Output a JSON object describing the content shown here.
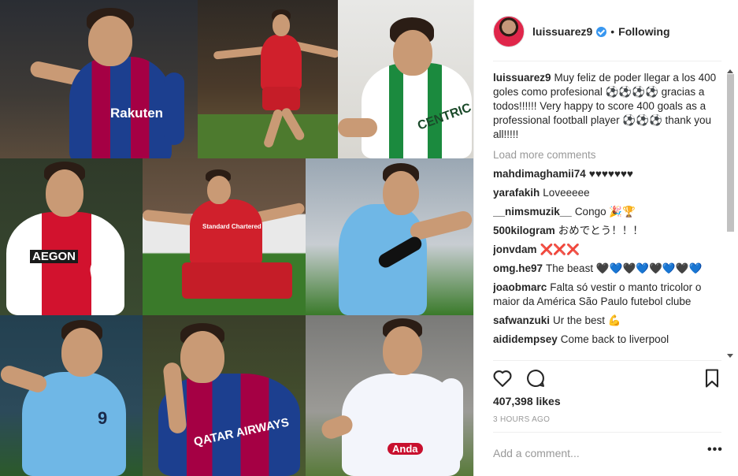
{
  "post": {
    "username": "luissuarez9",
    "follow_label": "Following",
    "dot": "•",
    "likes": "407,398 likes",
    "time_ago": "3 HOURS AGO",
    "add_comment_placeholder": "Add a comment...",
    "more_label": "•••"
  },
  "caption": {
    "user": "luissuarez9",
    "text": "Muy feliz de poder llegar a los 400 goles como profesional ⚽⚽⚽⚽ gracias a todos!!!!!! Very happy to score 400 goals as a professional football player ⚽⚽⚽ thank you all!!!!!"
  },
  "load_more": "Load more comments",
  "comments": [
    {
      "user": "mahdimaghamii74",
      "text": "♥♥♥♥♥♥♥"
    },
    {
      "user": "yarafakih",
      "text": "Loveeeee"
    },
    {
      "user": "__nimsmuzik__",
      "text": "Congo 🎉🏆"
    },
    {
      "user": "500kilogram",
      "text": "おめでとう！！！"
    },
    {
      "user": "jonvdam",
      "text": "❌❌❌"
    },
    {
      "user": "omg.he97",
      "text": "The beast 🖤💙🖤💙🖤💙🖤💙"
    },
    {
      "user": "joaobmarc",
      "text": "Falta só vestir o manto tricolor o maior da América São Paulo futebol clube"
    },
    {
      "user": "safwanzuki",
      "text": "Ur the best 💪"
    },
    {
      "user": "aididempsey",
      "text": "Come back to liverpool"
    }
  ],
  "kits": {
    "barca_sponsor": "Rakuten",
    "liverpool_sponsor": "Standard Chartered",
    "groningen_sponsor": "CENTRIC",
    "ajax_sponsor": "AEGON",
    "uruguay_number": "9",
    "qatar_sponsor": "QATAR AIRWAYS",
    "nacional_sponsor": "Anda"
  },
  "colors": {
    "verified": "#3897f0",
    "text": "#262626",
    "muted": "#999999",
    "barca_blue": "#1c3f8f",
    "barca_red": "#a50044",
    "liverpool_red": "#d0202c",
    "uruguay_sky": "#6fb7e6",
    "ajax_red": "#d2122e"
  },
  "icons": [
    "heart-icon",
    "comment-icon",
    "bookmark-icon",
    "more-options-icon",
    "verified-icon"
  ]
}
